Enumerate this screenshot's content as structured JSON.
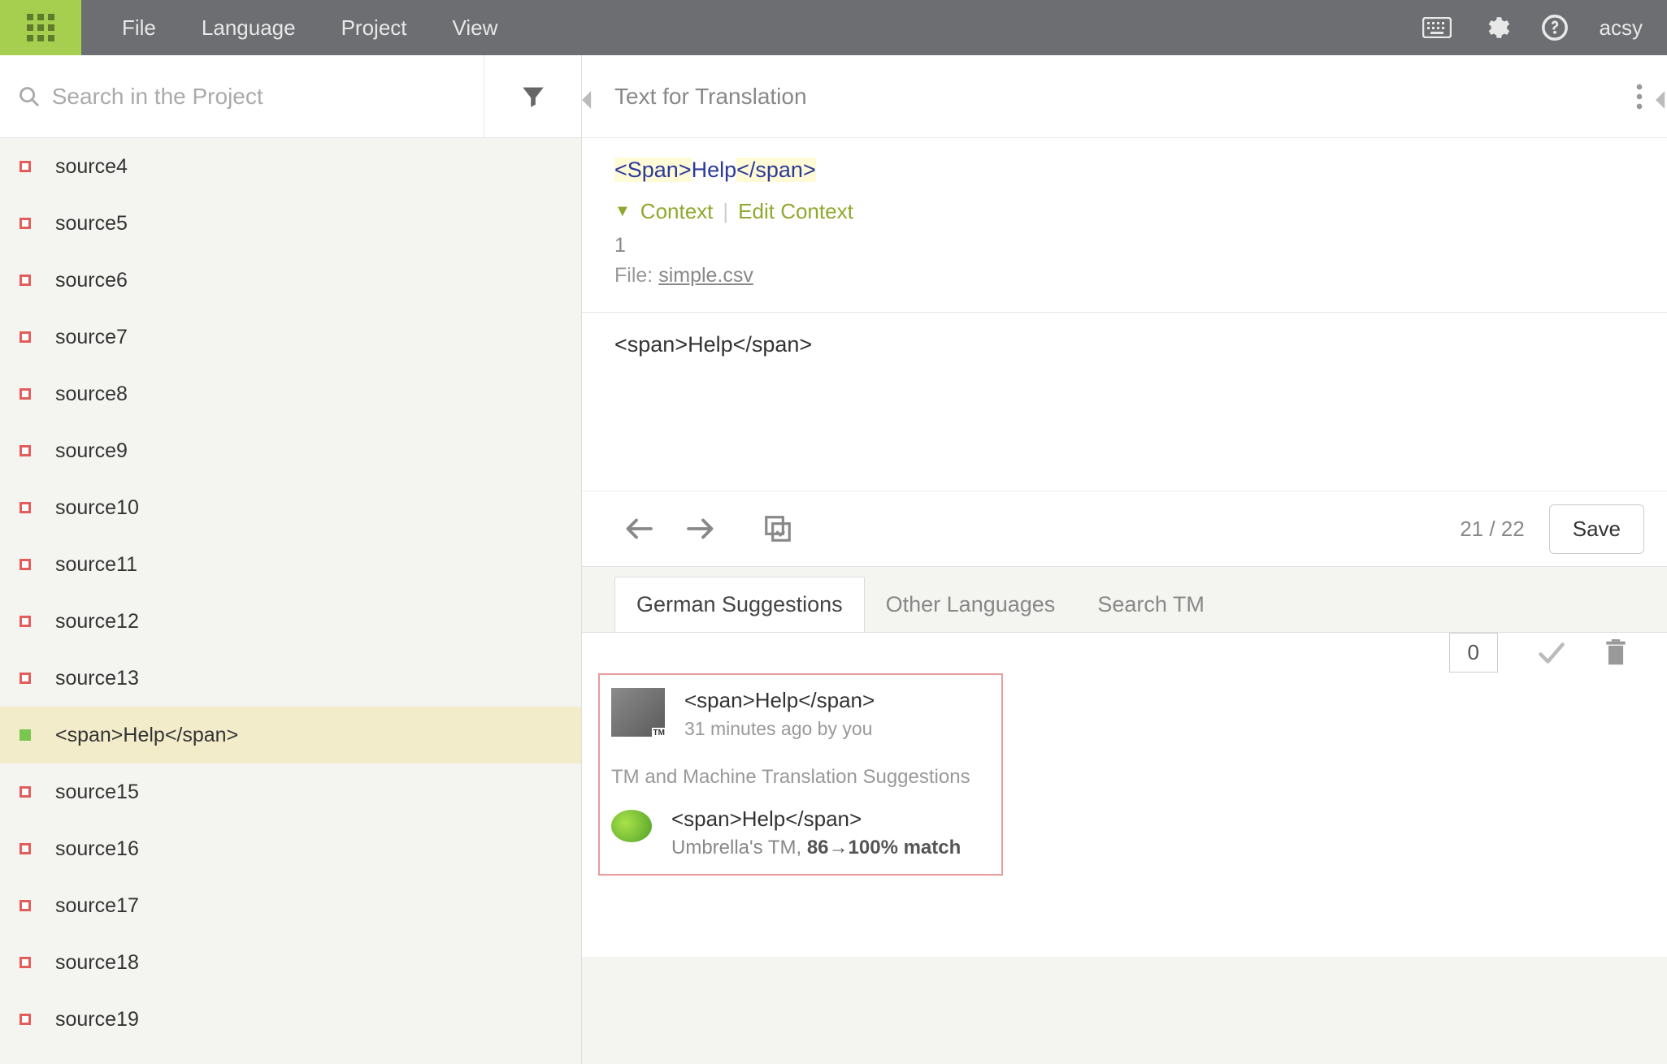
{
  "menu": {
    "file": "File",
    "language": "Language",
    "project": "Project",
    "view": "View"
  },
  "user": "acsy",
  "search": {
    "placeholder": "Search in the Project"
  },
  "sidebar": {
    "items": [
      {
        "label": "source4",
        "status": "red"
      },
      {
        "label": "source5",
        "status": "red"
      },
      {
        "label": "source6",
        "status": "red"
      },
      {
        "label": "source7",
        "status": "red"
      },
      {
        "label": "source8",
        "status": "red"
      },
      {
        "label": "source9",
        "status": "red"
      },
      {
        "label": "source10",
        "status": "red"
      },
      {
        "label": "source11",
        "status": "red"
      },
      {
        "label": "source12",
        "status": "red"
      },
      {
        "label": "source13",
        "status": "red"
      },
      {
        "label": "<span>Help</span>",
        "status": "green",
        "active": true
      },
      {
        "label": "source15",
        "status": "red"
      },
      {
        "label": "source16",
        "status": "red"
      },
      {
        "label": "source17",
        "status": "red"
      },
      {
        "label": "source18",
        "status": "red"
      },
      {
        "label": "source19",
        "status": "red"
      }
    ]
  },
  "editor": {
    "panel_title": "Text for Translation",
    "source_open_tag": "<Span>",
    "source_word": "Help",
    "source_close_tag": "</span>",
    "context_label": "Context",
    "edit_context": "Edit Context",
    "context_number": "1",
    "file_label": "File: ",
    "file_name": "simple.csv",
    "translation_text": "<span>Help</span>",
    "counter": "21 / 22",
    "save": "Save"
  },
  "tabs": {
    "german": "German Suggestions",
    "other": "Other Languages",
    "search_tm": "Search TM"
  },
  "suggestions": {
    "user_suggestion": {
      "text": "<span>Help</span>",
      "meta": "31 minutes ago by you",
      "votes": "0"
    },
    "tm_header": "TM and Machine Translation Suggestions",
    "tm_suggestion": {
      "text": "<span>Help</span>",
      "meta_prefix": "Umbrella's TM, ",
      "meta_match": "86→100% match"
    }
  }
}
